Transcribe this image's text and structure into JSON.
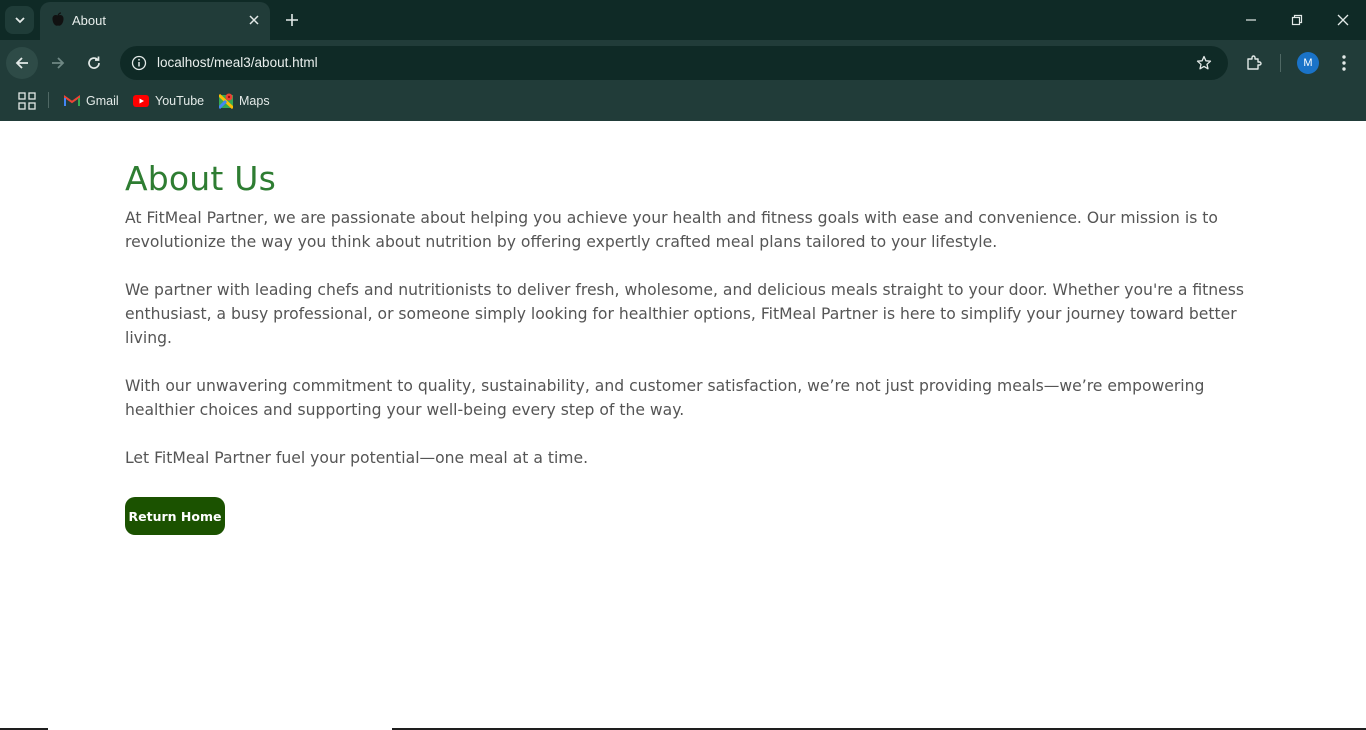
{
  "browser": {
    "tab": {
      "title": "About"
    },
    "address": {
      "url": "localhost/meal3/about.html"
    },
    "profile_initial": "M",
    "bookmarks": [
      {
        "label": "Gmail"
      },
      {
        "label": "YouTube"
      },
      {
        "label": "Maps"
      }
    ]
  },
  "page": {
    "title": "About Us",
    "paragraphs": [
      "At FitMeal Partner, we are passionate about helping you achieve your health and fitness goals with ease and convenience. Our mission is to revolutionize the way you think about nutrition by offering expertly crafted meal plans tailored to your lifestyle.",
      "We partner with leading chefs and nutritionists to deliver fresh, wholesome, and delicious meals straight to your door. Whether you're a fitness enthusiast, a busy professional, or someone simply looking for healthier options, FitMeal Partner is here to simplify your journey toward better living.",
      "With our unwavering commitment to quality, sustainability, and customer satisfaction, we’re not just providing meals—we’re empowering healthier choices and supporting your well-being every step of the way.",
      "Let FitMeal Partner fuel your potential—one meal at a time."
    ],
    "return_button": "Return Home"
  },
  "colors": {
    "title": "#2e7d32",
    "button": "#1b5200",
    "body_text": "#555555",
    "chrome_dark": "#0f2a26",
    "chrome": "#213c39"
  }
}
